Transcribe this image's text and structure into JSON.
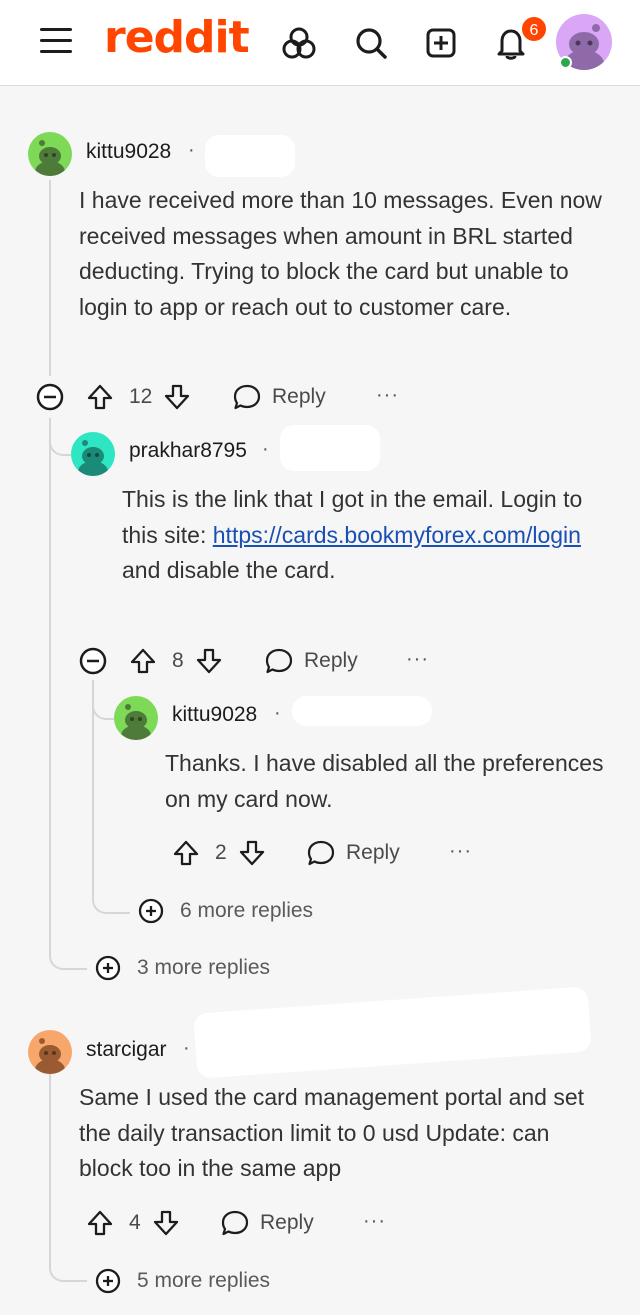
{
  "header": {
    "logo": "reddit",
    "notification_count": "6",
    "icons": [
      "menu-icon",
      "popular-icon",
      "search-icon",
      "create-post-icon",
      "notifications-icon"
    ]
  },
  "colors": {
    "brand": "#ff4500",
    "link": "#1a4fb3",
    "online": "#2aa84a"
  },
  "comments": [
    {
      "username": "kittu9028",
      "body": "I have received more than 10 messages. Even now received messages when amount in BRL started deducting. Trying to block the card but unable to login to app or reach out to customer care.",
      "votes": "12",
      "reply_label": "Reply",
      "more_label": "···"
    },
    {
      "username": "prakhar8795",
      "body_pre": "This is the link that I got in the email. Login to this site: ",
      "link": "https://cards.bookmyforex.com/login",
      "body_post": " and disable the card.",
      "votes": "8",
      "reply_label": "Reply",
      "more_label": "···"
    },
    {
      "username": "kittu9028",
      "body": "Thanks. I have disabled all the preferences on my card now.",
      "votes": "2",
      "reply_label": "Reply",
      "more_label": "···"
    },
    {
      "username": "starcigar",
      "body": "Same I used the card management portal and set the daily transaction limit to 0 usd Update: can block too in the same app",
      "votes": "4",
      "reply_label": "Reply",
      "more_label": "···"
    }
  ],
  "more_replies": [
    "6 more replies",
    "3 more replies",
    "5 more replies"
  ],
  "separator": "·"
}
